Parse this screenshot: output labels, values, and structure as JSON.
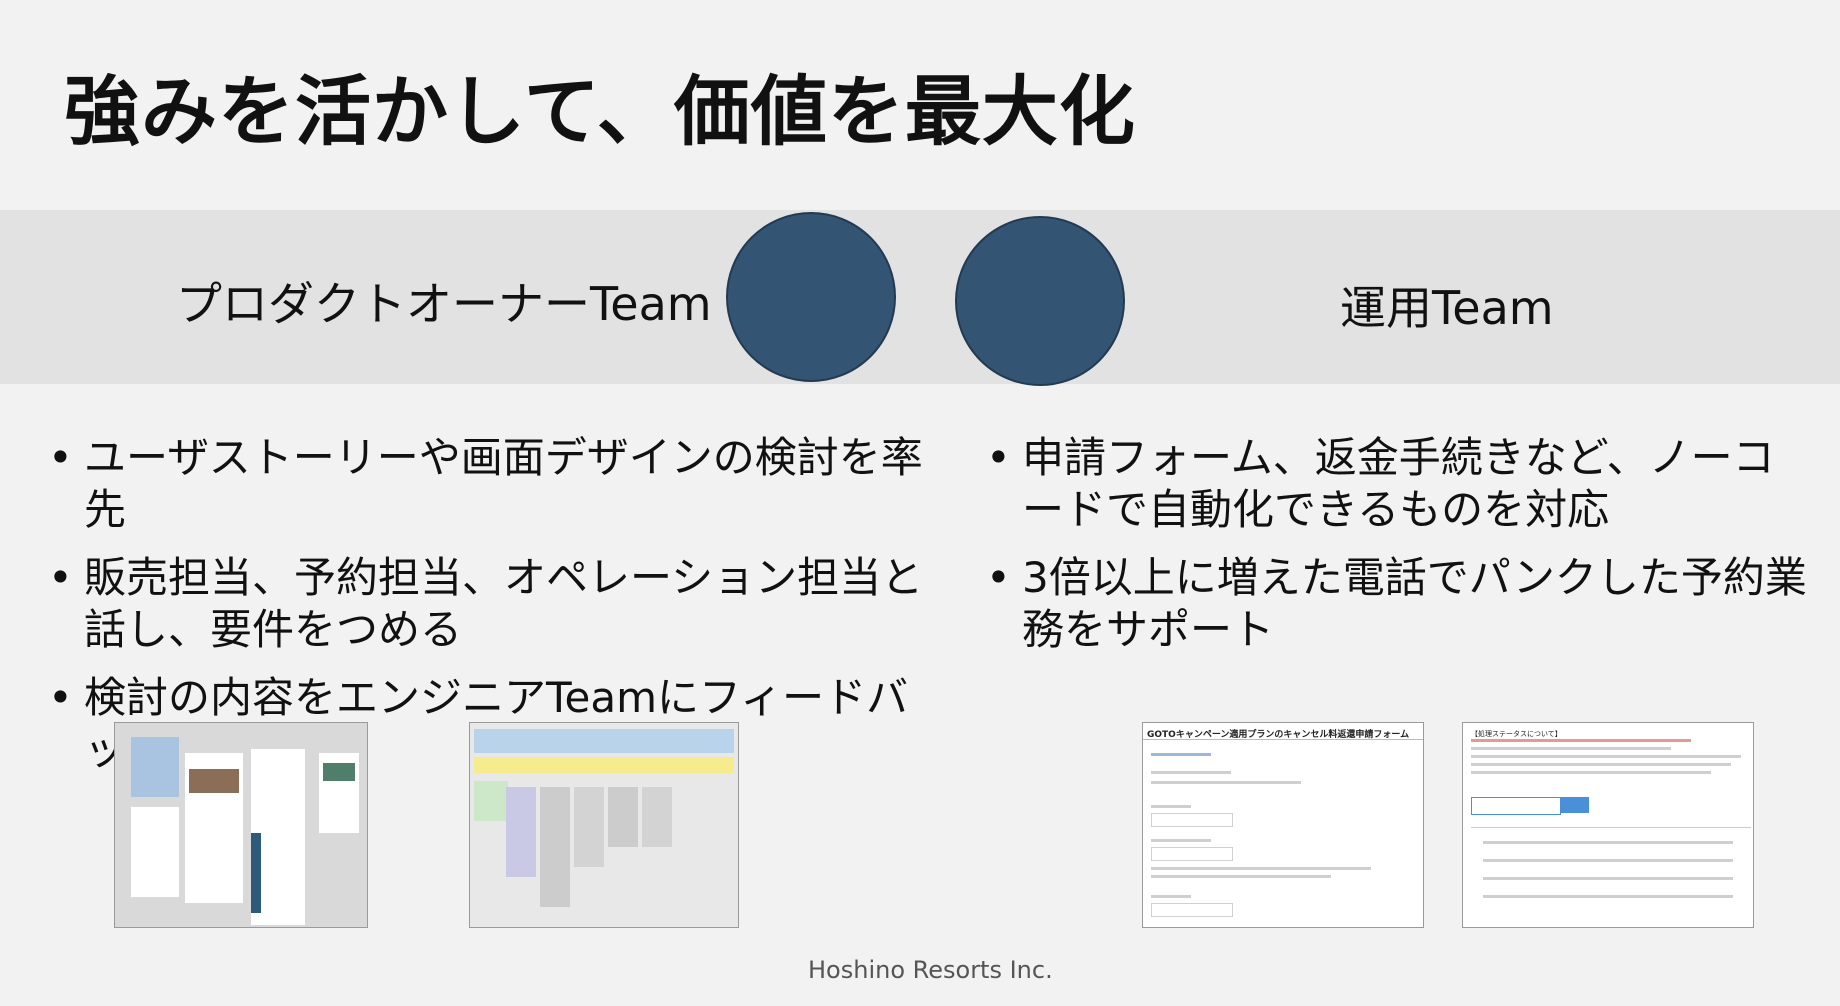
{
  "slide": {
    "title": "強みを活かして、価値を最大化",
    "left_team": {
      "label": "プロダクトオーナーTeam",
      "bullets": [
        "ユーザストーリーや画面デザインの検討を率先",
        "販売担当、予約担当、オペレーション担当と話し、要件をつめる",
        "検討の内容をエンジニアTeamにフィードバック"
      ]
    },
    "right_team": {
      "label": "運用Team",
      "bullets": [
        "申請フォーム、返金手続きなど、ノーコードで自動化できるものを対応",
        "3倍以上に増えた電話でパンクした予約業務をサポート"
      ]
    },
    "screenshots": {
      "form_title": "GOTOキャンペーン適用プランのキャンセル料返還申請フォーム",
      "status_note": "【処理ステータスについて】"
    },
    "footer": "Hoshino Resorts Inc."
  },
  "colors": {
    "circle": "#345473",
    "band": "#e2e2e2",
    "background": "#f2f2f2"
  }
}
